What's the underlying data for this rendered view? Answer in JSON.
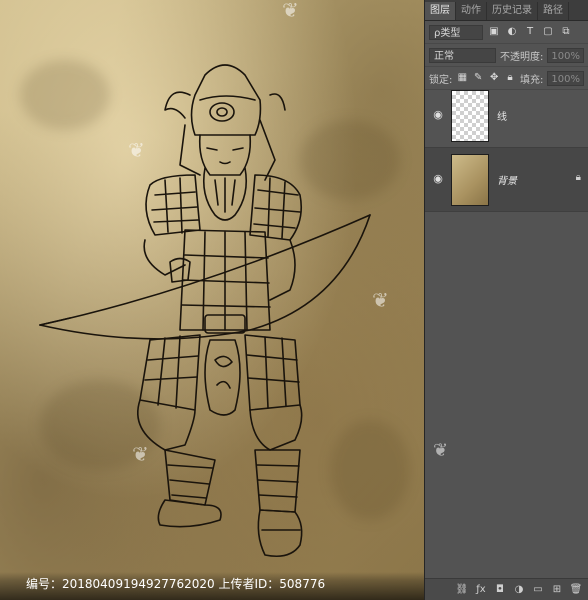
{
  "panel": {
    "tabs": [
      "图层",
      "动作",
      "历史记录",
      "路径"
    ],
    "filter_label": "ρ类型",
    "blend_mode": "正常",
    "opacity_label": "不透明度:",
    "opacity_value": "100%",
    "lock_label": "锁定:",
    "fill_label": "填充:",
    "fill_value": "100%",
    "layers": [
      {
        "name": "线",
        "visible": true,
        "locked": false
      },
      {
        "name": "背景",
        "visible": true,
        "locked": true
      }
    ],
    "footer_icons": [
      "link-icon",
      "fx-icon",
      "mask-icon",
      "adjustment-icon",
      "group-icon",
      "new-layer-icon",
      "trash-icon"
    ]
  },
  "canvas": {
    "caption": "编号：20180409194927762020 上传者ID：508776"
  },
  "colors": {
    "panel_bg": "#535353",
    "tab_bg": "#3d3d3d",
    "parchment": "#bca874"
  }
}
